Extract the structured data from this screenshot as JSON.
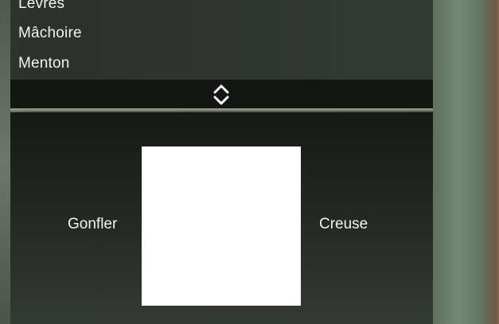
{
  "feature_list": {
    "items": [
      {
        "label": "Lèvres"
      },
      {
        "label": "Mâchoire"
      },
      {
        "label": "Menton"
      }
    ]
  },
  "toggle": {
    "icon": "chevron-up-down-icon"
  },
  "editor": {
    "left_label": "Gonfler",
    "right_label": "Creuse",
    "grid_color": "#ffffff"
  }
}
